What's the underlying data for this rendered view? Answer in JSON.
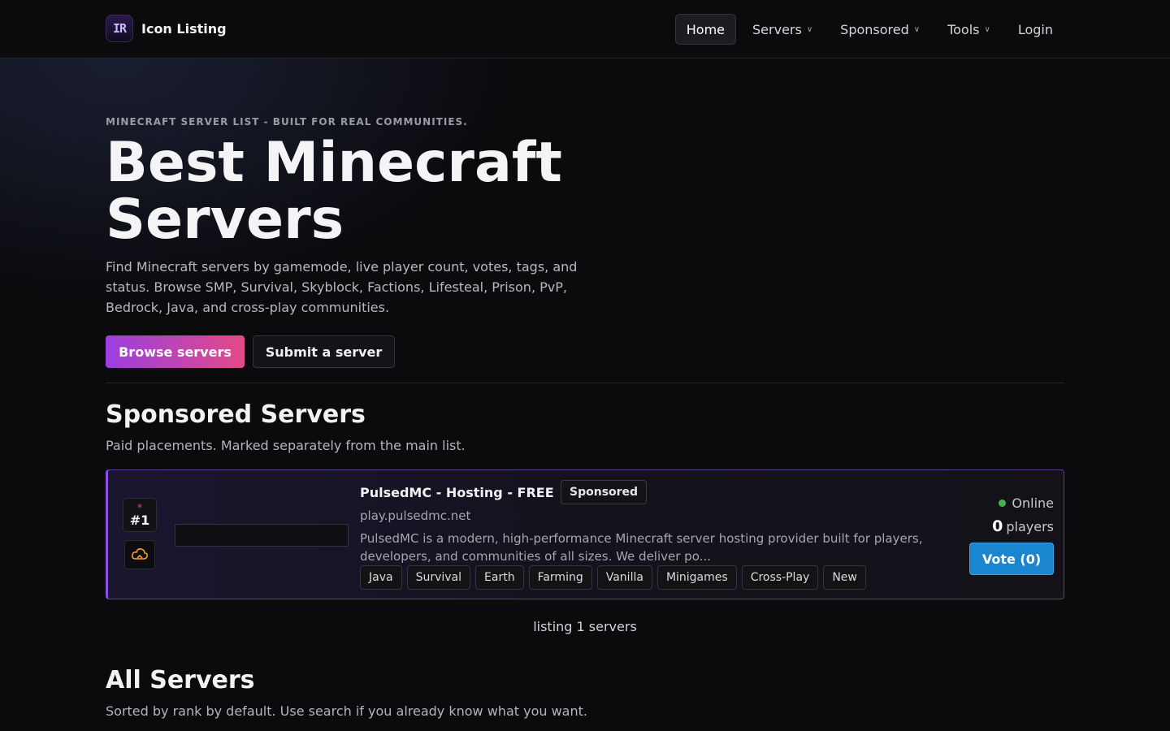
{
  "header": {
    "logo_text": "IR",
    "brand_name": "Icon Listing",
    "nav": [
      {
        "label": "Home",
        "dropdown": false,
        "active": true
      },
      {
        "label": "Servers",
        "dropdown": true,
        "active": false
      },
      {
        "label": "Sponsored",
        "dropdown": true,
        "active": false
      },
      {
        "label": "Tools",
        "dropdown": true,
        "active": false
      },
      {
        "label": "Login",
        "dropdown": false,
        "active": false
      }
    ],
    "chevron": "∨"
  },
  "hero": {
    "eyebrow": "MINECRAFT SERVER LIST - BUILT FOR REAL COMMUNITIES.",
    "title": "Best Minecraft Servers",
    "subtitle": "Find Minecraft servers by gamemode, live player count, votes, tags, and status. Browse SMP, Survival, Skyblock, Factions, Lifesteal, Prison, PvP, Bedrock, Java, and cross-play communities.",
    "browse_button": "Browse servers",
    "submit_button": "Submit a server"
  },
  "sponsored": {
    "heading": "Sponsored Servers",
    "description": "Paid placements. Marked separately from the main list.",
    "servers": [
      {
        "rank_marker": "*",
        "rank": "#1",
        "name": "PulsedMC - Hosting - FREE",
        "badge": "Sponsored",
        "address": "play.pulsedmc.net",
        "description": "PulsedMC is a modern, high-performance Minecraft server hosting provider built for players, developers, and communities of all sizes. We deliver po...",
        "tags": [
          "Java",
          "Survival",
          "Earth",
          "Farming",
          "Vanilla",
          "Minigames",
          "Cross-Play",
          "New"
        ],
        "status": "Online",
        "player_count": "0",
        "players_label": "players",
        "vote_label": "Vote (0)"
      }
    ],
    "listing_count": "listing 1 servers"
  },
  "all_servers": {
    "heading": "All Servers",
    "description": "Sorted by rank by default. Use search if you already know what you want."
  },
  "colors": {
    "accent_gradient_start": "#9b3fe0",
    "accent_gradient_end": "#e24a86",
    "vote_blue": "#1a86d0",
    "online_green": "#4caf50",
    "background": "#0b0b0e"
  }
}
